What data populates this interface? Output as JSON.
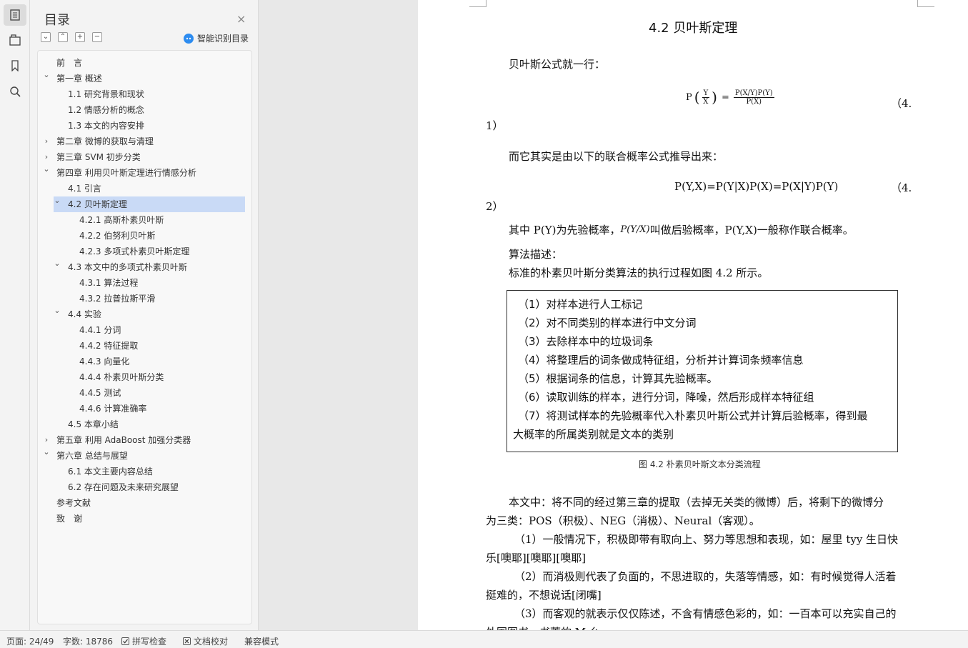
{
  "sidebar": {
    "icons": [
      "toc-icon",
      "bookmark-tab-icon",
      "bookmark-icon",
      "search-icon"
    ]
  },
  "toc": {
    "title": "目录",
    "close": "×",
    "tools": [
      "⌄",
      "⌃",
      "+",
      "−"
    ],
    "smart_label": "智能识别目录",
    "items": [
      {
        "label": "前　言",
        "level": 0,
        "chev": ""
      },
      {
        "label": "第一章  概述",
        "level": 0,
        "chev": "open"
      },
      {
        "label": "1.1  研究背景和现状",
        "level": 1,
        "chev": ""
      },
      {
        "label": "1.2  情感分析的概念",
        "level": 1,
        "chev": ""
      },
      {
        "label": "1.3  本文的内容安排",
        "level": 1,
        "chev": ""
      },
      {
        "label": "第二章  微博的获取与清理",
        "level": 0,
        "chev": "closed"
      },
      {
        "label": "第三章  SVM 初步分类",
        "level": 0,
        "chev": "closed"
      },
      {
        "label": "第四章  利用贝叶斯定理进行情感分析",
        "level": 0,
        "chev": "open"
      },
      {
        "label": "4.1  引言",
        "level": 1,
        "chev": ""
      },
      {
        "label": "4.2  贝叶斯定理",
        "level": 1,
        "chev": "open",
        "selected": true
      },
      {
        "label": "4.2.1  高斯朴素贝叶斯",
        "level": 2,
        "chev": ""
      },
      {
        "label": "4.2.2  伯努利贝叶斯",
        "level": 2,
        "chev": ""
      },
      {
        "label": "4.2.3  多项式朴素贝叶斯定理",
        "level": 2,
        "chev": ""
      },
      {
        "label": "4.3  本文中的多项式朴素贝叶斯",
        "level": 1,
        "chev": "open"
      },
      {
        "label": "4.3.1  算法过程",
        "level": 2,
        "chev": ""
      },
      {
        "label": "4.3.2  拉普拉斯平滑",
        "level": 2,
        "chev": ""
      },
      {
        "label": "4.4  实验",
        "level": 1,
        "chev": "open"
      },
      {
        "label": "4.4.1  分词",
        "level": 2,
        "chev": ""
      },
      {
        "label": "4.4.2  特征提取",
        "level": 2,
        "chev": ""
      },
      {
        "label": "4.4.3  向量化",
        "level": 2,
        "chev": ""
      },
      {
        "label": "4.4.4  朴素贝叶斯分类",
        "level": 2,
        "chev": ""
      },
      {
        "label": "4.4.5  测试",
        "level": 2,
        "chev": ""
      },
      {
        "label": "4.4.6  计算准确率",
        "level": 2,
        "chev": ""
      },
      {
        "label": "4.5  本章小结",
        "level": 1,
        "chev": ""
      },
      {
        "label": "第五章  利用 AdaBoost 加强分类器",
        "level": 0,
        "chev": "closed"
      },
      {
        "label": "第六章  总结与展望",
        "level": 0,
        "chev": "open"
      },
      {
        "label": "6.1  本文主要内容总结",
        "level": 1,
        "chev": ""
      },
      {
        "label": "6.2  存在问题及未来研究展望",
        "level": 1,
        "chev": ""
      },
      {
        "label": "参考文献",
        "level": 0,
        "chev": ""
      },
      {
        "label": "致　谢",
        "level": 0,
        "chev": ""
      }
    ]
  },
  "doc": {
    "heading": "4.2  贝叶斯定理",
    "intro": "贝叶斯公式就一行：",
    "eq1": {
      "lhs": "P",
      "lhs_num": "Y",
      "lhs_den": "X",
      "rhs_num": "P(X/Y)P(Y)",
      "rhs_den": "P(X)",
      "no_a": "（4.",
      "no_b": "1）"
    },
    "derive": "而它其实是由以下的联合概率公式推导出来：",
    "eq2": {
      "text": "P(Y,X)=P(Y|X)P(X)=P(X|Y)P(Y)",
      "no_a": "（4.",
      "no_b": "2）"
    },
    "prior_a": "其中 P(Y)为先验概率，",
    "prior_frac": "P(Y/X)",
    "prior_b": "叫做后验概率，P(Y,X)一般称作联合概率。",
    "algo_title": "算法描述：",
    "algo_intro": "标准的朴素贝叶斯分类算法的执行过程如图 4.2 所示。",
    "steps": [
      "（1）对样本进行人工标记",
      "（2）对不同类别的样本进行中文分词",
      "（3）去除样本中的垃圾词条",
      "（4）将整理后的词条做成特征组，分析并计算词条频率信息",
      "（5）根据词条的信息，计算其先验概率。",
      "（6）读取训练的样本，进行分词，降噪，然后形成样本特征组",
      "（7）将测试样本的先验概率代入朴素贝叶斯公式并计算后验概率，得到最",
      "大概率的所属类别就是文本的类别"
    ],
    "caption": "图 4.2  朴素贝叶斯文本分类流程",
    "para_lines": [
      "本文中：将不同的经过第三章的提取（去掉无关类的微博）后，将剩下的微博分",
      "为三类：POS（积极）、NEG（消极）、Neural（客观）。",
      "（1）一般情况下，积极即带有取向上、努力等思想和表现，如：屋里 tyy 生日快",
      "乐[噢耶][噢耶][噢耶]",
      "（2）而消极则代表了负面的，不思进取的，失落等情感，如：有时候觉得人活着",
      "挺难的，不想说话[闭嘴]",
      "（3）而客观的就表示仅仅陈述，不含有情感色彩的，如：一百本可以充实自己的",
      "外国图书，书荒的 M 么"
    ]
  },
  "status": {
    "page": "页面: 24/49",
    "words": "字数: 18786",
    "spell": "拼写检查",
    "proof": "文档校对",
    "compat": "兼容模式"
  }
}
